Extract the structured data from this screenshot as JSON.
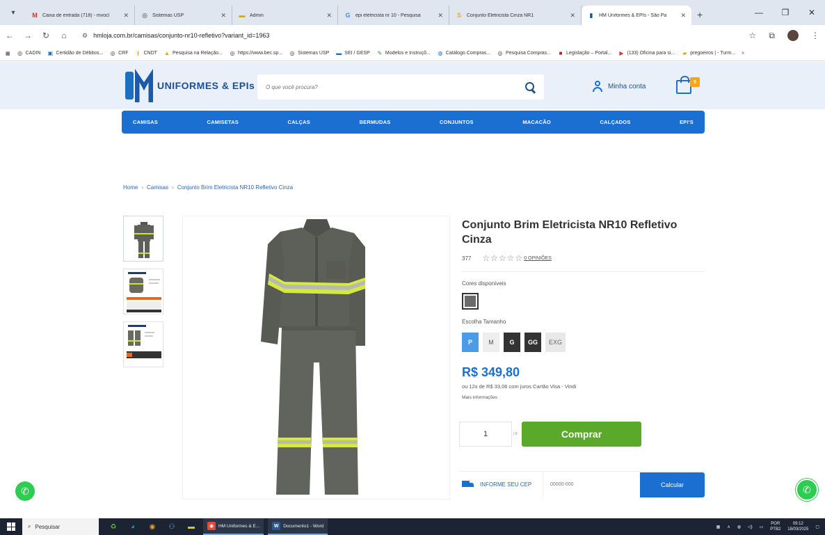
{
  "browser": {
    "tabs": [
      {
        "title": "Caixa de entrada (718) - mvocl",
        "fav": "M",
        "fav_color": "#d93025"
      },
      {
        "title": "Sistemas USP",
        "fav": "◎",
        "fav_color": "#444444"
      },
      {
        "title": "Admin",
        "fav": "▬",
        "fav_color": "#d4a514"
      },
      {
        "title": "epi eletricista nr 10 - Pesquisa",
        "fav": "G",
        "fav_color": "#4285f4"
      },
      {
        "title": "Conjunto Eletricista Cinza NR1",
        "fav": "S",
        "fav_color": "#f2a61c"
      },
      {
        "title": "HM Uniformes & EPIs - São Pa",
        "fav": "▮",
        "fav_color": "#1a4f94",
        "active": true
      }
    ],
    "url": "hmloja.com.br/camisas/conjunto-nr10-refletivo?variant_id=1963",
    "bookmarks": [
      "CADIN",
      "Certidão de Débitos...",
      "CRF",
      "CNDT",
      "Pesquisa na Relação...",
      "https://www.bec.sp...",
      "Sistemas USP",
      "SEI / GESP",
      "Modelos e Instruçõ...",
      "Catálogo Compras...",
      "Pesquisa Compras...",
      "Legislação – Portal...",
      "(133) Oficina para si...",
      "pregoeiros | - Turm..."
    ]
  },
  "header": {
    "logo_text": "UNIFORMES & EPIs",
    "search_placeholder": "O que você procura?",
    "account_label": "Minha conta",
    "cart_count": "0"
  },
  "nav": {
    "items": [
      "CAMISAS",
      "CAMISETAS",
      "CALÇAS",
      "BERMUDAS",
      "CONJUNTOS",
      "MACACÃO",
      "CALÇADOS",
      "EPI'S"
    ]
  },
  "breadcrumb": {
    "home": "Home",
    "category": "Camisas",
    "current": "Conjunto Brim Eletricista NR10 Refletivo Cinza",
    "sep": "›"
  },
  "product": {
    "title": "Conjunto Brim Eletricista NR10 Refletivo Cinza",
    "code": "377",
    "opinions": "0 OPINIÕES",
    "rating": 0,
    "colors_label": "Cores disponíveis",
    "size_label": "Escolha Tamanho",
    "sizes": [
      "P",
      "M",
      "G",
      "GG",
      "EXG"
    ],
    "price": "R$ 349,80",
    "installments": "ou 12x de R$ 33,06 com juros Cartão Visa - Vindi",
    "more_info": "Mais informações",
    "quantity": "1",
    "qty_unit": "/ 0",
    "buy_label": "Comprar",
    "cep_label": "INFORME SEU CEP",
    "cep_placeholder": "00000-000",
    "calc_label": "Calcular"
  },
  "taskbar": {
    "search_label": "Pesquisar",
    "tasks": [
      {
        "label": "HM Uniformes & E...",
        "icon": "◉",
        "color": "#dd4b39"
      },
      {
        "label": "Documento1 - Word",
        "icon": "W",
        "color": "#2b5797"
      }
    ],
    "lang": "POR",
    "lang_sub": "PTB2",
    "time": "09:12",
    "date": "18/03/2025"
  },
  "colors": {
    "brand_blue": "#1a6fd0",
    "buy_green": "#5aa92a",
    "header_bg": "#e9f0f9",
    "badge_orange": "#f2a61c"
  }
}
